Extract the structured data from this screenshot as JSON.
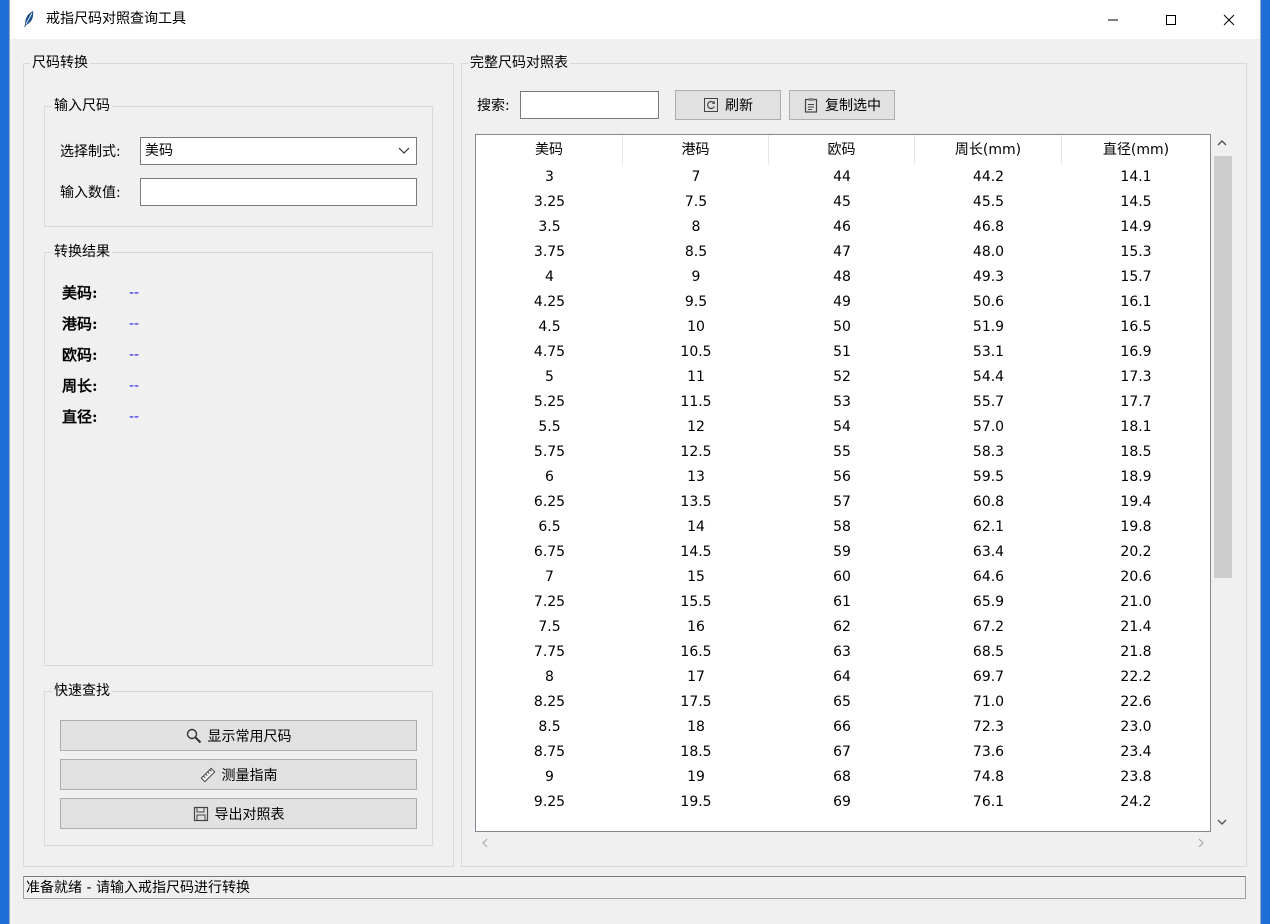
{
  "window": {
    "title": "戒指尺码对照查询工具"
  },
  "left_panel": {
    "title": "尺码转换",
    "input_group": {
      "title": "输入尺码",
      "system_label": "选择制式:",
      "system_value": "美码",
      "value_label": "输入数值:",
      "value_input": ""
    },
    "result_group": {
      "title": "转换结果",
      "rows": [
        {
          "label": "美码:",
          "value": "--"
        },
        {
          "label": "港码:",
          "value": "--"
        },
        {
          "label": "欧码:",
          "value": "--"
        },
        {
          "label": "周长:",
          "value": "--"
        },
        {
          "label": "直径:",
          "value": "--"
        }
      ]
    },
    "quick_group": {
      "title": "快速查找",
      "buttons": [
        {
          "label": "显示常用尺码",
          "icon": "magnifier-icon"
        },
        {
          "label": "测量指南",
          "icon": "ruler-icon"
        },
        {
          "label": "导出对照表",
          "icon": "floppy-disk-icon"
        }
      ]
    }
  },
  "right_panel": {
    "title": "完整尺码对照表",
    "search_label": "搜索:",
    "search_value": "",
    "refresh_label": "刷新",
    "copy_label": "复制选中",
    "columns": [
      "美码",
      "港码",
      "欧码",
      "周长(mm)",
      "直径(mm)"
    ],
    "rows": [
      [
        "3",
        "7",
        "44",
        "44.2",
        "14.1"
      ],
      [
        "3.25",
        "7.5",
        "45",
        "45.5",
        "14.5"
      ],
      [
        "3.5",
        "8",
        "46",
        "46.8",
        "14.9"
      ],
      [
        "3.75",
        "8.5",
        "47",
        "48.0",
        "15.3"
      ],
      [
        "4",
        "9",
        "48",
        "49.3",
        "15.7"
      ],
      [
        "4.25",
        "9.5",
        "49",
        "50.6",
        "16.1"
      ],
      [
        "4.5",
        "10",
        "50",
        "51.9",
        "16.5"
      ],
      [
        "4.75",
        "10.5",
        "51",
        "53.1",
        "16.9"
      ],
      [
        "5",
        "11",
        "52",
        "54.4",
        "17.3"
      ],
      [
        "5.25",
        "11.5",
        "53",
        "55.7",
        "17.7"
      ],
      [
        "5.5",
        "12",
        "54",
        "57.0",
        "18.1"
      ],
      [
        "5.75",
        "12.5",
        "55",
        "58.3",
        "18.5"
      ],
      [
        "6",
        "13",
        "56",
        "59.5",
        "18.9"
      ],
      [
        "6.25",
        "13.5",
        "57",
        "60.8",
        "19.4"
      ],
      [
        "6.5",
        "14",
        "58",
        "62.1",
        "19.8"
      ],
      [
        "6.75",
        "14.5",
        "59",
        "63.4",
        "20.2"
      ],
      [
        "7",
        "15",
        "60",
        "64.6",
        "20.6"
      ],
      [
        "7.25",
        "15.5",
        "61",
        "65.9",
        "21.0"
      ],
      [
        "7.5",
        "16",
        "62",
        "67.2",
        "21.4"
      ],
      [
        "7.75",
        "16.5",
        "63",
        "68.5",
        "21.8"
      ],
      [
        "8",
        "17",
        "64",
        "69.7",
        "22.2"
      ],
      [
        "8.25",
        "17.5",
        "65",
        "71.0",
        "22.6"
      ],
      [
        "8.5",
        "18",
        "66",
        "72.3",
        "23.0"
      ],
      [
        "8.75",
        "18.5",
        "67",
        "73.6",
        "23.4"
      ],
      [
        "9",
        "19",
        "68",
        "74.8",
        "23.8"
      ],
      [
        "9.25",
        "19.5",
        "69",
        "76.1",
        "24.2"
      ]
    ]
  },
  "status": {
    "text": "准备就绪 - 请输入戒指尺码进行转换"
  },
  "colors": {
    "result_value": "#1e1ee6",
    "scroll_thumb": "#cdcdcd"
  }
}
